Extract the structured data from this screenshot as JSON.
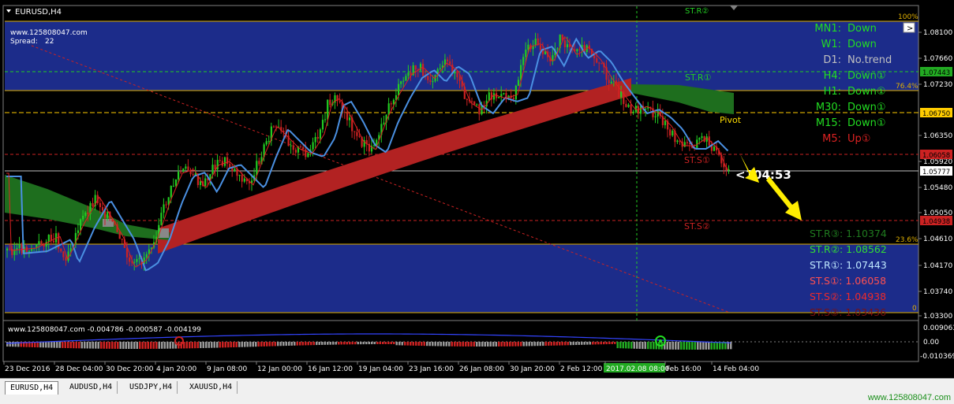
{
  "chart": {
    "symbol_title": "EURUSD,H4",
    "website": "www.125808047.com",
    "spread_label": "Spread:",
    "spread_value": "22",
    "timer": "<104:53",
    "pivot_label": "Pivot",
    "fib_100": "100%",
    "fib_764": "76.4%",
    "fib_236": "23.6%",
    "fib_0": "0",
    "lines": {
      "str1": "ST.R①",
      "str2": "ST.R②",
      "sts1": "ST.S①",
      "sts2": "ST.S②"
    },
    "colors": {
      "background": "#000000",
      "channel": "#1c2c8a",
      "up_candle": "#22cc22",
      "down_candle": "#cc2222",
      "cloud_red": "#b22222",
      "cloud_green": "#1e6e1e",
      "ma_blue": "#4a90e2",
      "accent_yellow": "#ffd700"
    }
  },
  "price_axis": {
    "labels": [
      "1.08100",
      "1.07660",
      "1.07230",
      "1.06350",
      "1.05920",
      "1.05480",
      "1.05050",
      "1.04610",
      "1.04170",
      "1.03740",
      "1.03300"
    ],
    "tags": [
      {
        "text": "1.07443",
        "bg": "#22aa22"
      },
      {
        "text": "1.06750",
        "bg": "#ffcc00"
      },
      {
        "text": "1.06058",
        "bg": "#cc2222"
      },
      {
        "text": "1.05777",
        "bg": "#ffffff"
      },
      {
        "text": "1.04938",
        "bg": "#cc2222"
      }
    ]
  },
  "trend_panel": [
    {
      "tf": "MN1:",
      "state": "Down",
      "color": "#22dd22"
    },
    {
      "tf": "W1:",
      "state": "Down",
      "color": "#22dd22"
    },
    {
      "tf": "D1:",
      "state": "No.trend",
      "color": "#c0c0c0"
    },
    {
      "tf": "H4:",
      "state": "Down①",
      "color": "#22dd22"
    },
    {
      "tf": "H1:",
      "state": "Down①",
      "color": "#22dd22"
    },
    {
      "tf": "M30:",
      "state": "Down①",
      "color": "#22dd22"
    },
    {
      "tf": "M15:",
      "state": "Down①",
      "color": "#22dd22"
    },
    {
      "tf": "M5:",
      "state": "Up①",
      "color": "#dd2222"
    }
  ],
  "level_panel": [
    {
      "label": "ST.R③: 1.10374",
      "color": "#1f7a1f"
    },
    {
      "label": "ST.R②: 1.08562",
      "color": "#33dd33"
    },
    {
      "label": "ST.R①: 1.07443",
      "color": "#bfe8ff"
    },
    {
      "label": "ST.S①: 1.06058",
      "color": "#ff5050"
    },
    {
      "label": "ST.S②: 1.04938",
      "color": "#ee2a2a"
    },
    {
      "label": "ST.S③: 1.03436",
      "color": "#7a1010"
    }
  ],
  "oscillator": {
    "header": "www.125808047.com -0.004786 -0.000587 -0.004199",
    "labels": [
      "0.009063",
      "0.00",
      "-0.010369"
    ]
  },
  "time_axis": {
    "labels": [
      "23 Dec 2016",
      "28 Dec 04:00",
      "30 Dec 20:00",
      "4 Jan 20:00",
      "9 Jan 08:00",
      "12 Jan 00:00",
      "16 Jan 12:00",
      "19 Jan 04:00",
      "23 Jan 16:00",
      "26 Jan 08:00",
      "30 Jan 20:00",
      "2 Feb 12:00",
      "2017.02.08 08:00",
      "Feb 16:00",
      "14 Feb 04:00"
    ]
  },
  "tabs": [
    {
      "label": "EURUSD,H4",
      "active": true
    },
    {
      "label": "AUDUSD,H4",
      "active": false
    },
    {
      "label": "USDJPY,H4",
      "active": false
    },
    {
      "label": "XAUUSD,H4",
      "active": false
    }
  ],
  "footer_site": "www.125808047.com"
}
